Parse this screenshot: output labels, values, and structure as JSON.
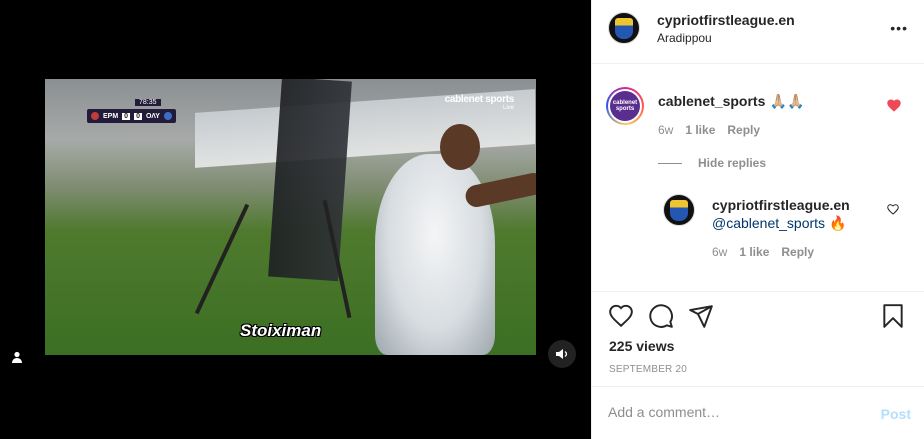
{
  "header": {
    "username": "cypriotfirstleague.en",
    "location": "Aradippou",
    "more_icon": "more-horizontal-icon"
  },
  "video": {
    "scorebug": {
      "clock": "78:35",
      "home": "ΕΡΜ",
      "home_score": "0",
      "away_score": "0",
      "away": "ΟΛΥ"
    },
    "broadcaster": "cablenet sports",
    "broadcaster_live": "Live",
    "sponsor": "Stoiximan"
  },
  "comments": [
    {
      "username": "cablenet_sports",
      "text": "🙏🏼🙏🏼",
      "age": "6w",
      "likes": "1 like",
      "reply": "Reply",
      "liked": true,
      "avatar_text": "cablenet sports"
    },
    {
      "username": "cypriotfirstleague.en",
      "text": "@cablenet_sports 🔥",
      "age": "6w",
      "likes": "1 like",
      "reply": "Reply",
      "liked": false
    }
  ],
  "hide_replies": "Hide replies",
  "views": "225 views",
  "date": "SEPTEMBER 20",
  "composer": {
    "placeholder": "Add a comment…",
    "post_label": "Post"
  },
  "colors": {
    "like_red": "#ed4956",
    "post_blue": "#b2dffc",
    "muted": "#8e8e8e"
  }
}
